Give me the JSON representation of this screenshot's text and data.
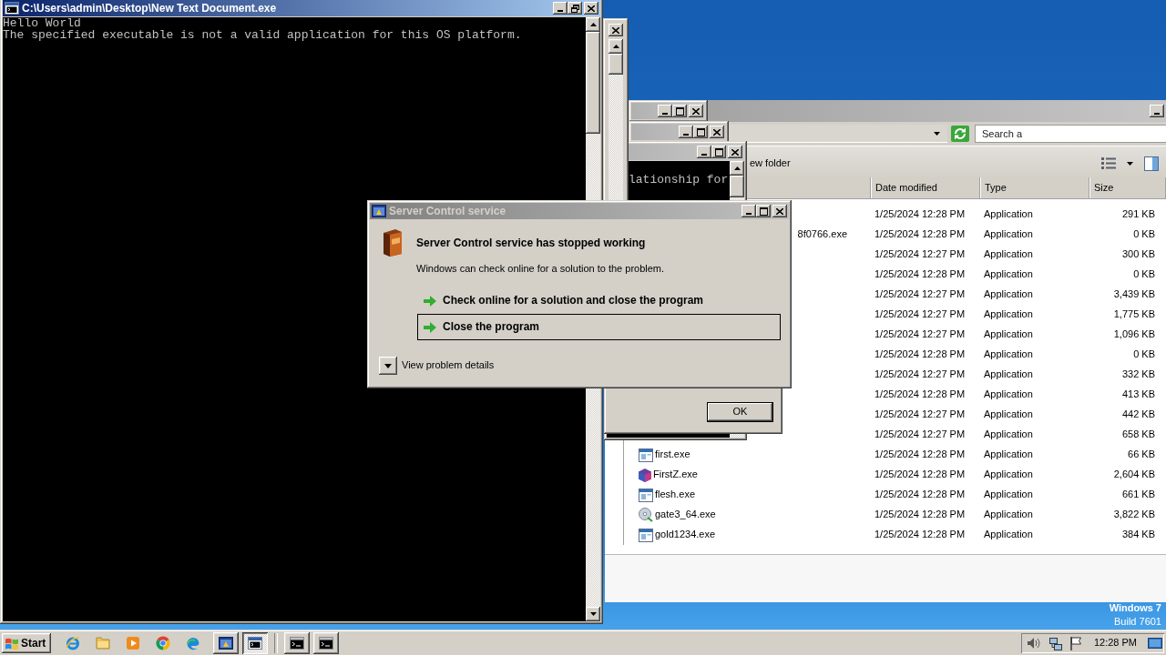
{
  "console": {
    "title": "C:\\Users\\admin\\Desktop\\New Text Document.exe",
    "maximized": true,
    "lines": [
      "Hello World",
      "The specified executable is not a valid application for this OS platform."
    ]
  },
  "stacked_windows": [
    {
      "maximized": false
    },
    {
      "maximized": false
    },
    {
      "maximized": false,
      "lines": [
        "lationship for"
      ]
    }
  ],
  "explorer": {
    "search": {
      "placeholder": "Search a"
    },
    "toolbar": [
      "ew folder"
    ],
    "columns": [
      "Date modified",
      "Type",
      "Size"
    ],
    "rows": [
      {
        "date": "1/25/2024 12:28 PM",
        "type": "Application",
        "size": "291 KB"
      },
      {
        "name": "8f0766.exe",
        "date": "1/25/2024 12:28 PM",
        "type": "Application",
        "size": "0 KB"
      },
      {
        "date": "1/25/2024 12:27 PM",
        "type": "Application",
        "size": "300 KB"
      },
      {
        "date": "1/25/2024 12:28 PM",
        "type": "Application",
        "size": "0 KB"
      },
      {
        "date": "1/25/2024 12:27 PM",
        "type": "Application",
        "size": "3,439 KB"
      },
      {
        "date": "1/25/2024 12:27 PM",
        "type": "Application",
        "size": "1,775 KB"
      },
      {
        "date": "1/25/2024 12:27 PM",
        "type": "Application",
        "size": "1,096 KB"
      },
      {
        "date": "1/25/2024 12:28 PM",
        "type": "Application",
        "size": "0 KB"
      },
      {
        "date": "1/25/2024 12:27 PM",
        "type": "Application",
        "size": "332 KB"
      },
      {
        "date": "1/25/2024 12:28 PM",
        "type": "Application",
        "size": "413 KB"
      },
      {
        "date": "1/25/2024 12:27 PM",
        "type": "Application",
        "size": "442 KB"
      },
      {
        "date": "1/25/2024 12:27 PM",
        "type": "Application",
        "size": "658 KB"
      },
      {
        "kind": "app",
        "name": "first.exe",
        "date": "1/25/2024 12:28 PM",
        "type": "Application",
        "size": "66 KB"
      },
      {
        "kind": "package",
        "name": "FirstZ.exe",
        "date": "1/25/2024 12:28 PM",
        "type": "Application",
        "size": "2,604 KB"
      },
      {
        "kind": "app",
        "name": "flesh.exe",
        "date": "1/25/2024 12:28 PM",
        "type": "Application",
        "size": "661 KB"
      },
      {
        "kind": "setup",
        "name": "gate3_64.exe",
        "date": "1/25/2024 12:28 PM",
        "type": "Application",
        "size": "3,822 KB"
      },
      {
        "kind": "app",
        "name": "gold1234.exe",
        "date": "1/25/2024 12:28 PM",
        "type": "Application",
        "size": "384 KB"
      }
    ]
  },
  "dialog": {
    "title": "Server Control service",
    "maximized": false,
    "heading": "Server Control service has stopped working",
    "message": "Windows can check online for a solution to the problem.",
    "options": [
      {
        "label": "Check online for a solution and close the program",
        "selected": false
      },
      {
        "label": "Close the program",
        "selected": true
      }
    ],
    "details": {
      "label": "View problem details",
      "expanded": false
    }
  },
  "message_box": {
    "buttons": [
      "OK"
    ]
  },
  "desktop": {
    "os_label": [
      "Windows 7",
      "Build 7601"
    ]
  },
  "taskbar": {
    "start": "Start",
    "tasks": [
      {
        "kind": "report",
        "selected": false
      },
      {
        "kind": "console",
        "selected": true
      },
      {
        "kind": "terminal",
        "selected": false
      },
      {
        "kind": "terminal",
        "selected": false
      }
    ],
    "clock": "12:28 PM"
  }
}
